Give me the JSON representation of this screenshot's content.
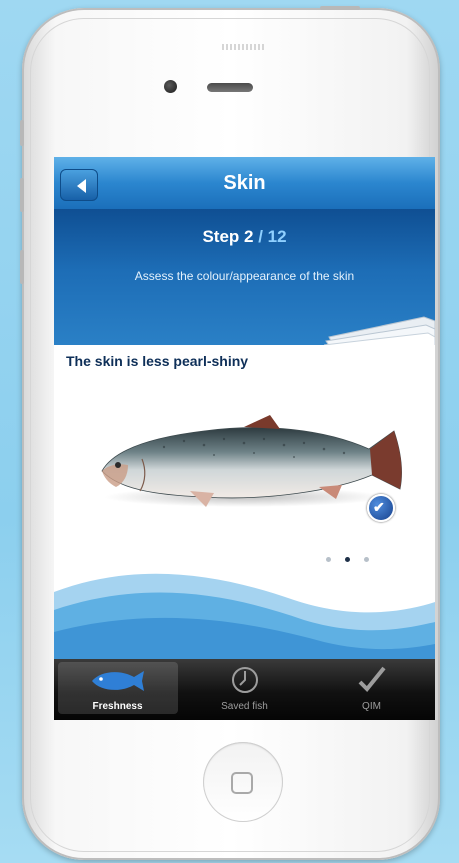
{
  "nav": {
    "title": "Skin"
  },
  "step": {
    "current": "Step 2",
    "separator": " / ",
    "total": "12",
    "instruction": "Assess the colour/appearance of the skin"
  },
  "card": {
    "title": "The skin is less pearl-shiny",
    "page_index": 2,
    "page_count": 3
  },
  "tabs": [
    {
      "label": "Freshness",
      "icon": "fish-icon",
      "selected": true
    },
    {
      "label": "Saved fish",
      "icon": "clock-icon",
      "selected": false
    },
    {
      "label": "QIM",
      "icon": "checkmark-icon",
      "selected": false
    }
  ],
  "colors": {
    "accent": "#1d6db6",
    "nav_top": "#5fb1e8",
    "header_dark": "#0f4f93",
    "fish_tab": "#2f7fd6",
    "wave": "#5fb0e3"
  }
}
